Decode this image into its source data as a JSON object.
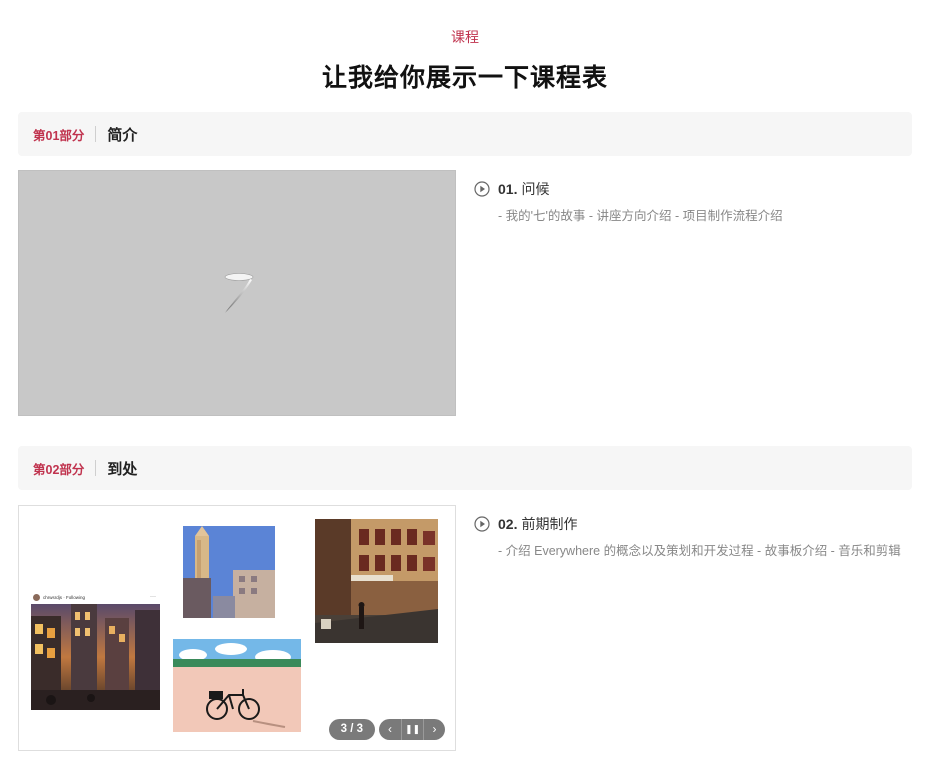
{
  "header": {
    "eyebrow": "课程",
    "title": "让我给你展示一下课程表"
  },
  "sections": [
    {
      "number": "第01部分",
      "title": "简介",
      "lesson": {
        "number": "01.",
        "title": "问候",
        "description": "- 我的'七'的故事 - 讲座方向介绍 - 项目制作流程介绍"
      }
    },
    {
      "number": "第02部分",
      "title": "到处",
      "lesson": {
        "number": "02.",
        "title": "前期制作",
        "description": "- 介绍 Everywhere 的概念以及策划和开发过程 - 故事板介绍 - 音乐和剪辑"
      },
      "gallery": {
        "counter": "3 / 3",
        "prev_icon": "chevron-left-icon",
        "pause_icon": "pause-icon",
        "next_icon": "chevron-right-icon",
        "post_header": "chrwsrdjs · Following"
      }
    }
  ],
  "colors": {
    "accent": "#c0334e",
    "section_bg": "#f6f6f6",
    "placeholder_bg": "#c8c8c8",
    "muted_text": "#888888"
  }
}
